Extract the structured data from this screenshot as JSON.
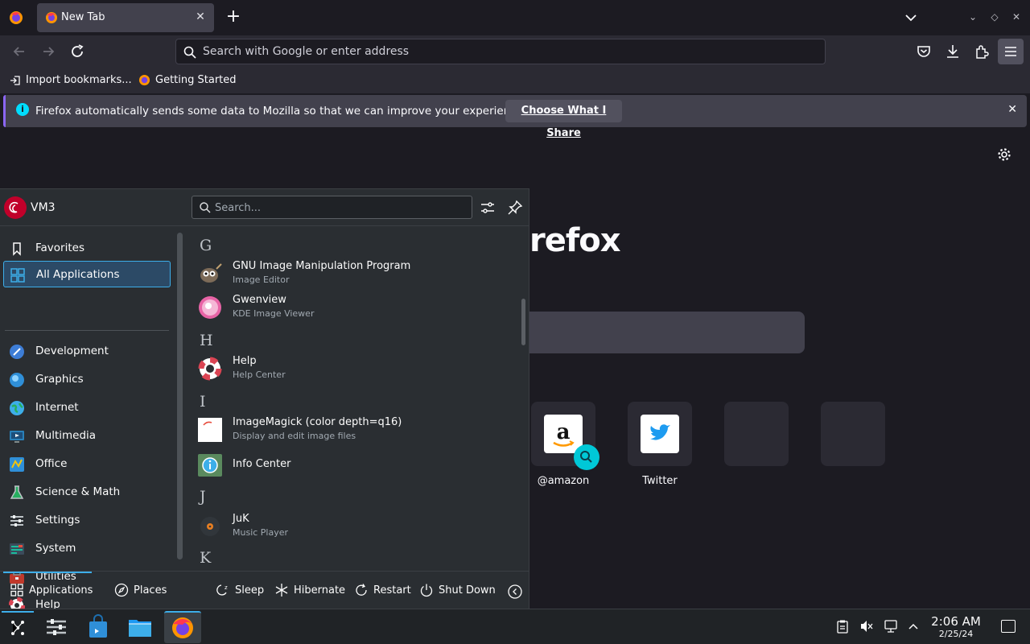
{
  "browser": {
    "tab_title": "New Tab",
    "url_placeholder": "Search with Google or enter address",
    "bookmarks": [
      "Import bookmarks...",
      "Getting Started"
    ],
    "notification": {
      "message": "Firefox automatically sends some data to Mozilla so that we can improve your experience.",
      "button": "Choose What I Share"
    },
    "newtab": {
      "wordmark_partial": "refox",
      "tiles": [
        "@amazon",
        "Twitter"
      ]
    }
  },
  "launcher": {
    "username": "VM3",
    "search_placeholder": "Search...",
    "categories": [
      "Favorites",
      "All Applications",
      "Development",
      "Graphics",
      "Internet",
      "Multimedia",
      "Office",
      "Science & Math",
      "Settings",
      "System",
      "Utilities",
      "Help"
    ],
    "active_category": "All Applications",
    "letters": [
      "G",
      "H",
      "I",
      "J",
      "K"
    ],
    "apps": [
      {
        "name": "GNU Image Manipulation Program",
        "desc": "Image Editor"
      },
      {
        "name": "Gwenview",
        "desc": "KDE Image Viewer"
      },
      {
        "name": "Help",
        "desc": "Help Center"
      },
      {
        "name": "ImageMagick (color depth=q16)",
        "desc": "Display and edit image files"
      },
      {
        "name": "Info Center",
        "desc": ""
      },
      {
        "name": "JuK",
        "desc": "Music Player"
      }
    ],
    "footer": {
      "applications": "Applications",
      "places": "Places",
      "sleep": "Sleep",
      "hibernate": "Hibernate",
      "restart": "Restart",
      "shutdown": "Shut Down"
    }
  },
  "taskbar": {
    "time": "2:06 AM",
    "date": "2/25/24"
  },
  "colors": {
    "kde_accent": "#3daee9",
    "firefox_bg": "#1c1b22",
    "launcher_bg": "#2a2e32"
  }
}
